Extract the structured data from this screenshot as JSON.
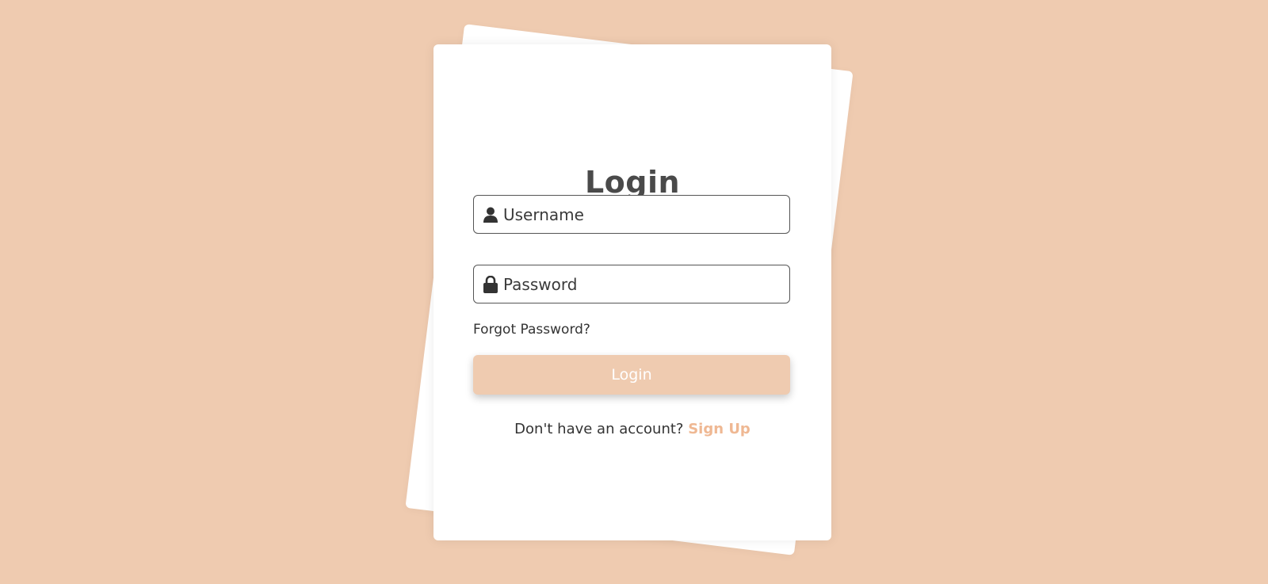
{
  "login_form": {
    "title": "Login",
    "username": {
      "placeholder": "Username",
      "value": "",
      "icon": "user-icon"
    },
    "password": {
      "placeholder": "Password",
      "value": "",
      "icon": "lock-icon"
    },
    "forgot_password": "Forgot Password?",
    "submit_label": "Login",
    "signup_prompt": "Don't have an account?",
    "signup_link": "Sign Up"
  },
  "colors": {
    "background": "#efcbb0",
    "button": "#efcbb0",
    "link_accent": "#efb893",
    "title": "#4a4a4a"
  }
}
